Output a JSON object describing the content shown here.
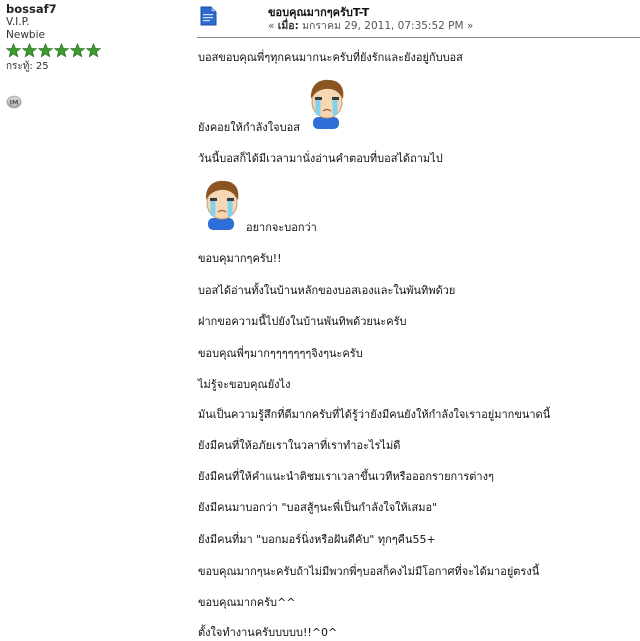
{
  "poster": {
    "name": "bossaf7",
    "title": "V.I.P.",
    "rank": "Newbie",
    "star_count": 6,
    "star_color": "#3c9a2e",
    "posts_label": "กระทู้: 25"
  },
  "post": {
    "subject": "ขอบคุณมากๆครับT-T",
    "meta_prefix": "«",
    "meta_label": "เมื่อ:",
    "meta_date": "มกราคม 29, 2011, 07:35:52 PM",
    "meta_suffix": "»",
    "lines": [
      "บอสขอบคุณพี่ๆทุกคนมากนะครับที่ยังรักและยังอยู่กับบอส",
      "ยังคอยให้กำลังใจบอส",
      "วันนี้บอสก็ได้มีเวลามานั่งอ่านคำตอบที่บอสได้ถามไป",
      "อยากจะบอกว่า",
      "ขอบคุมากๆครับ!!",
      "บอสได้อ่านทั้งในบ้านหลักของบอสเองและในพันทิพด้วย",
      "ฝากขอความนี้ไปยังในบ้านพันทิพด้วยนะครับ",
      "ขอบคุณพี่ๆมากๆๆๆๆๆๆๆจิงๆนะครับ",
      "ไม่รู้จะขอบคุณยังไง",
      "มันเป็นความรู้สึกที่ดีมากครับที่ได้รู้ว่ายังมีคนยังให้กำลังใจเราอยู่มากขนาดนี้",
      "ยังมีคนที่ให้อภัยเราในวลาที่เราทำอะไรไม่ดี",
      "ยังมีคนที่ให้คำแนะนำติชมเราเวลาขึ้นเวทีหรือออกรายการต่างๆ",
      "ยังมีคนมาบอกว่า \"บอสสู้ๆนะพี่เป็นกำลังใจให้เสมอ\"",
      "ยังมีคนที่มา \"บอกมอร์นิ่งหรือฝันดีคับ\" ทุกๆคืน55+",
      "ขอบคุณมากๆนะครับถ้าไม่มีพวกพี่ๆบอสก็คงไม่มีโอกาศที่จะได้มาอยู่ตรงนี้",
      "ขอบคุณมากครับ^^",
      "ตั้งใจทำงานครับบบบบ!!^0^"
    ]
  }
}
